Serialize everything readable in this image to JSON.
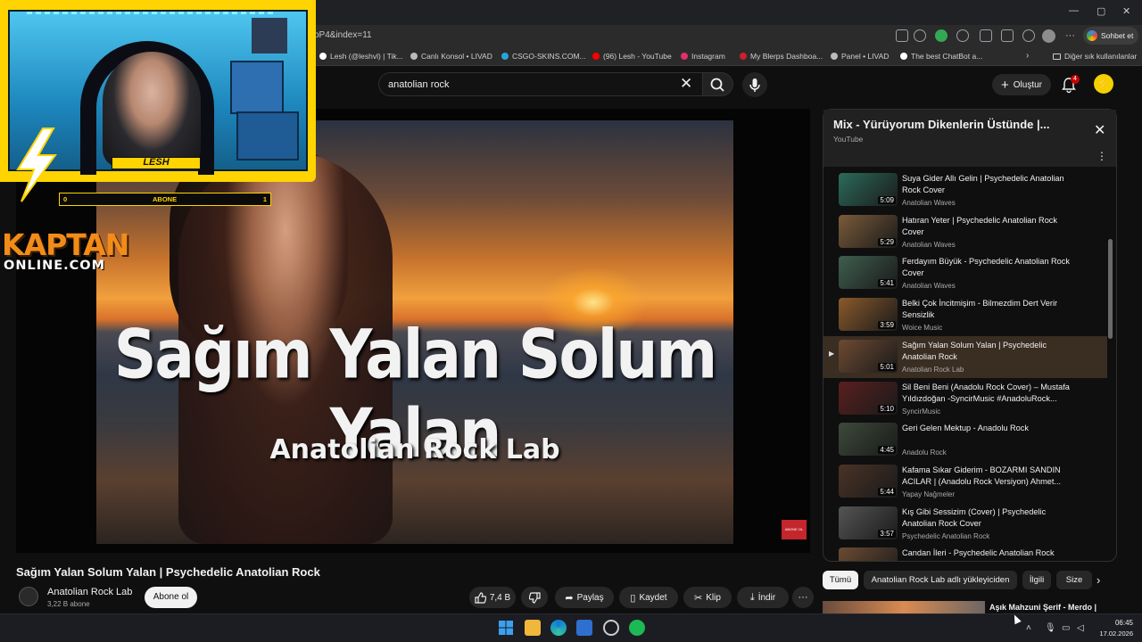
{
  "browser": {
    "url_fragment": "oP4&index=11",
    "chat_button": "Sohbet et",
    "bookmarks": [
      {
        "label": "Lesh (@leshvl) | Tik...",
        "color": "#ffffff"
      },
      {
        "label": "Canlı Konsol • LIVAD",
        "color": "#bbbbbb"
      },
      {
        "label": "CSGO-SKINS.COM...",
        "color": "#2aa3d8"
      },
      {
        "label": "(96) Lesh - YouTube",
        "color": "#ff0000"
      },
      {
        "label": "Instagram",
        "color": "#e1306c"
      },
      {
        "label": "My Blerps Dashboa...",
        "color": "#cc1f2f"
      },
      {
        "label": "Panel • LIVAD",
        "color": "#bbbbbb"
      },
      {
        "label": "The best ChatBot a...",
        "color": "#ffffff"
      }
    ],
    "bookmarks_overflow": "Diğer sık kullanılanlar"
  },
  "youtube": {
    "search_value": "anatolian rock",
    "create_label": "Oluştur",
    "notification_count": "4"
  },
  "overlay": {
    "streamer_name": "LESH",
    "sub_goal_start": "0",
    "sub_goal_label": "ABONE",
    "sub_goal_end": "1",
    "brand_line1": "KAPTAN",
    "brand_line2": "ONLINE.COM"
  },
  "video": {
    "thumbnail_title": "Sağım Yalan Solum Yalan",
    "thumbnail_subtitle": "Anatolian Rock Lab",
    "title": "Sağım Yalan Solum Yalan | Psychedelic Anatolian Rock",
    "channel": "Anatolian Rock Lab",
    "subscribers": "3,22 B abone",
    "subscribe_label": "Abone ol",
    "likes": "7,4 B",
    "actions": {
      "share": "Paylaş",
      "save": "Kaydet",
      "clip": "Klip",
      "download": "İndir"
    }
  },
  "playlist": {
    "title": "Mix - Yürüyorum Dikenlerin Üstünde |...",
    "subtitle": "YouTube",
    "items": [
      {
        "title": "Suya Gider Allı Gelin | Psychedelic Anatolian Rock Cover",
        "channel": "Anatolian Waves",
        "duration": "5:09",
        "thumb": "#2c6b5a"
      },
      {
        "title": "Hatıran Yeter | Psychedelic Anatolian Rock Cover",
        "channel": "Anatolian Waves",
        "duration": "5:29",
        "thumb": "#7a5b3a"
      },
      {
        "title": "Ferdayım Büyük - Psychedelic Anatolian Rock Cover",
        "channel": "Anatolian Waves",
        "duration": "5:41",
        "thumb": "#3f5e4f"
      },
      {
        "title": "Belki Çok İncitmişim - Bilmezdim Dert Verir Sensizlik",
        "channel": "Woice Music",
        "duration": "3:59",
        "thumb": "#8a5a2c"
      },
      {
        "title": "Sağım Yalan Solum Yalan | Psychedelic Anatolian Rock",
        "channel": "Anatolian Rock Lab",
        "duration": "5:01",
        "thumb": "#6e4a32",
        "active": true
      },
      {
        "title": "Sil Beni Beni (Anadolu Rock Cover) – Mustafa Yıldızdoğan -SyncirMusic #AnadoluRock...",
        "channel": "SyncirMusic",
        "duration": "5:10",
        "thumb": "#5a1f1f"
      },
      {
        "title": "Geri Gelen Mektup - Anadolu Rock",
        "channel": "Anadolu Rock",
        "duration": "4:45",
        "thumb": "#3d4a3a"
      },
      {
        "title": "Kafama Sıkar Giderim - BOZARMI SANDIN ACILAR | (Anadolu Rock Versiyon) Ahmet...",
        "channel": "Yapay Nağmeler",
        "duration": "5:44",
        "thumb": "#4a3326"
      },
      {
        "title": "Kış Gibi Sessizim (Cover) | Psychedelic Anatolian Rock Cover",
        "channel": "Psychedelic Anatolian Rock",
        "duration": "3:57",
        "thumb": "#555555"
      },
      {
        "title": "Candan İleri - Psychedelic Anatolian Rock",
        "channel": "",
        "duration": "",
        "thumb": "#6b4b33"
      }
    ]
  },
  "chips": [
    "Tümü",
    "Anatolian Rock Lab adlı yükleyiciden",
    "İlgili",
    "Size"
  ],
  "next_video_title": "Aşık Mahzuni Şerif - Merdo |",
  "taskbar": {
    "time": "06:45",
    "date": "17.02.2026"
  }
}
